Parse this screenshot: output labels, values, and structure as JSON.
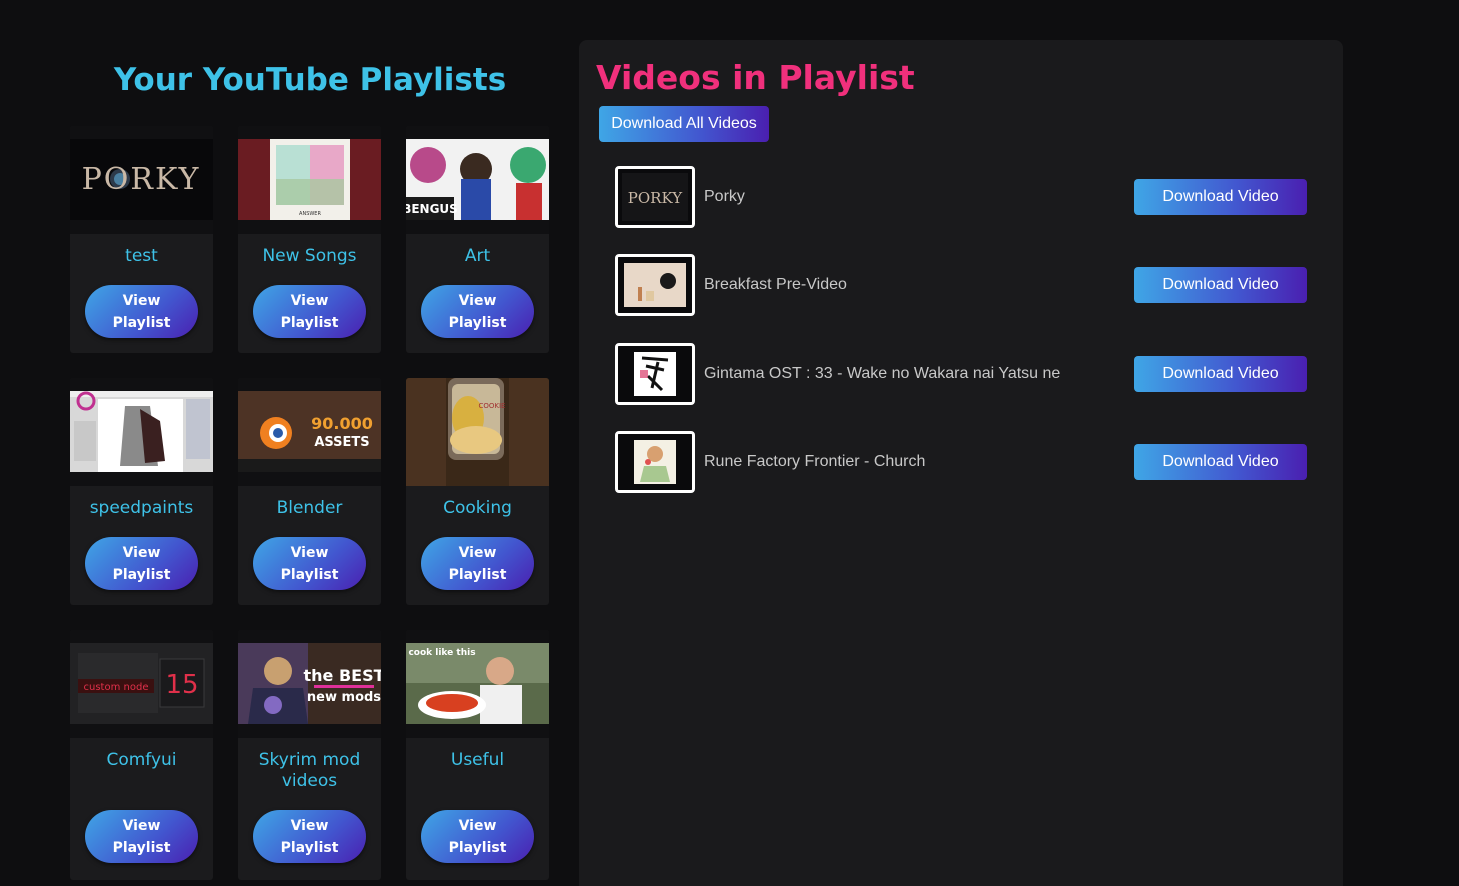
{
  "left": {
    "title": "Your YouTube Playlists",
    "view_button_label": "View Playlist",
    "playlists": [
      {
        "name": "test",
        "thumb_text": "PORKY"
      },
      {
        "name": "New Songs",
        "thumb_text": "ANSWER"
      },
      {
        "name": "Art",
        "thumb_text": "BENGUS"
      },
      {
        "name": "speedpaints",
        "thumb_text": ""
      },
      {
        "name": "Blender",
        "thumb_text": "90.000 ASSETS"
      },
      {
        "name": "Cooking",
        "thumb_text": "COOKIE"
      },
      {
        "name": "Comfyui",
        "thumb_text": "custom node 15"
      },
      {
        "name": "Skyrim mod videos",
        "thumb_text": "the BEST new mods"
      },
      {
        "name": "Useful",
        "thumb_text": "cook like this"
      }
    ]
  },
  "right": {
    "title": "Videos in Playlist",
    "download_all_label": "Download All Videos",
    "download_video_label": "Download Video",
    "videos": [
      {
        "title": "Porky",
        "thumb_text": "PORKY"
      },
      {
        "title": "Breakfast Pre-Video"
      },
      {
        "title": "Gintama OST : 33 - Wake no Wakara nai Yatsu ne"
      },
      {
        "title": "Rune Factory Frontier - Church"
      }
    ]
  }
}
